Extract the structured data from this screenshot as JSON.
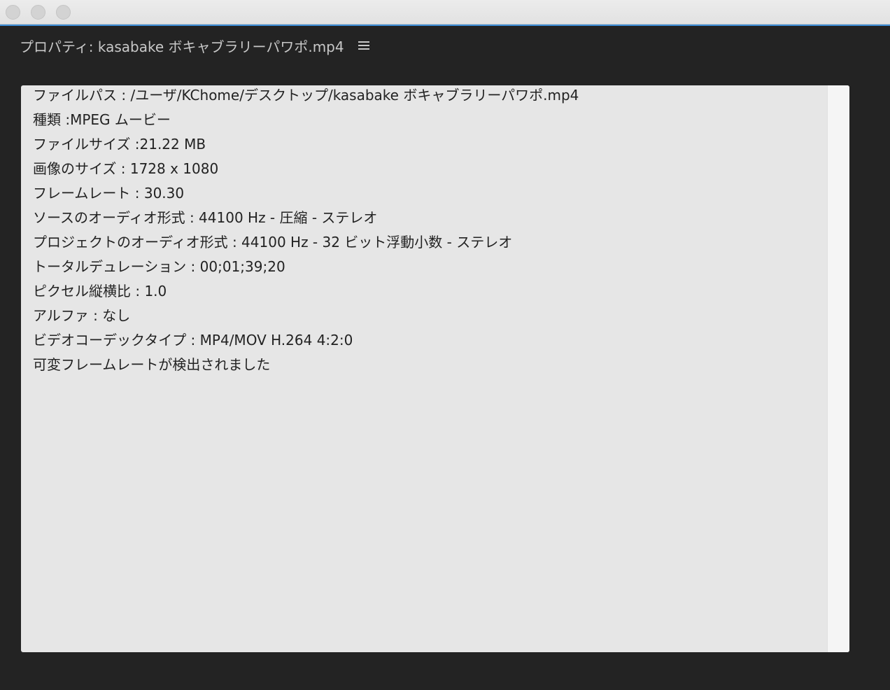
{
  "window": {
    "traffic_lights": [
      "close",
      "minimize",
      "zoom"
    ]
  },
  "panel": {
    "title": "プロパティ: kasabake ボキャブラリーパワポ.mp4",
    "menu_icon": "hamburger-menu-icon"
  },
  "properties": {
    "lines": [
      "ファイルパス : /ユーザ/KChome/デスクトップ/kasabake ボキャブラリーパワポ.mp4",
      "種類 :MPEG ムービー",
      "ファイルサイズ :21.22 MB",
      "画像のサイズ : 1728 x 1080",
      "フレームレート : 30.30",
      "ソースのオーディオ形式 : 44100 Hz - 圧縮 - ステレオ",
      "プロジェクトのオーディオ形式 : 44100 Hz - 32 ビット浮動小数 - ステレオ",
      "トータルデュレーション : 00;01;39;20",
      "ピクセル縦横比 : 1.0",
      "アルファ : なし",
      "ビデオコーデックタイプ : MP4/MOV H.264 4:2:0",
      "可変フレームレートが検出されました"
    ]
  },
  "colors": {
    "background": "#232323",
    "accent": "#3d8fd9",
    "content_bg": "#e6e6e6",
    "header_text": "#c8c8c8"
  }
}
